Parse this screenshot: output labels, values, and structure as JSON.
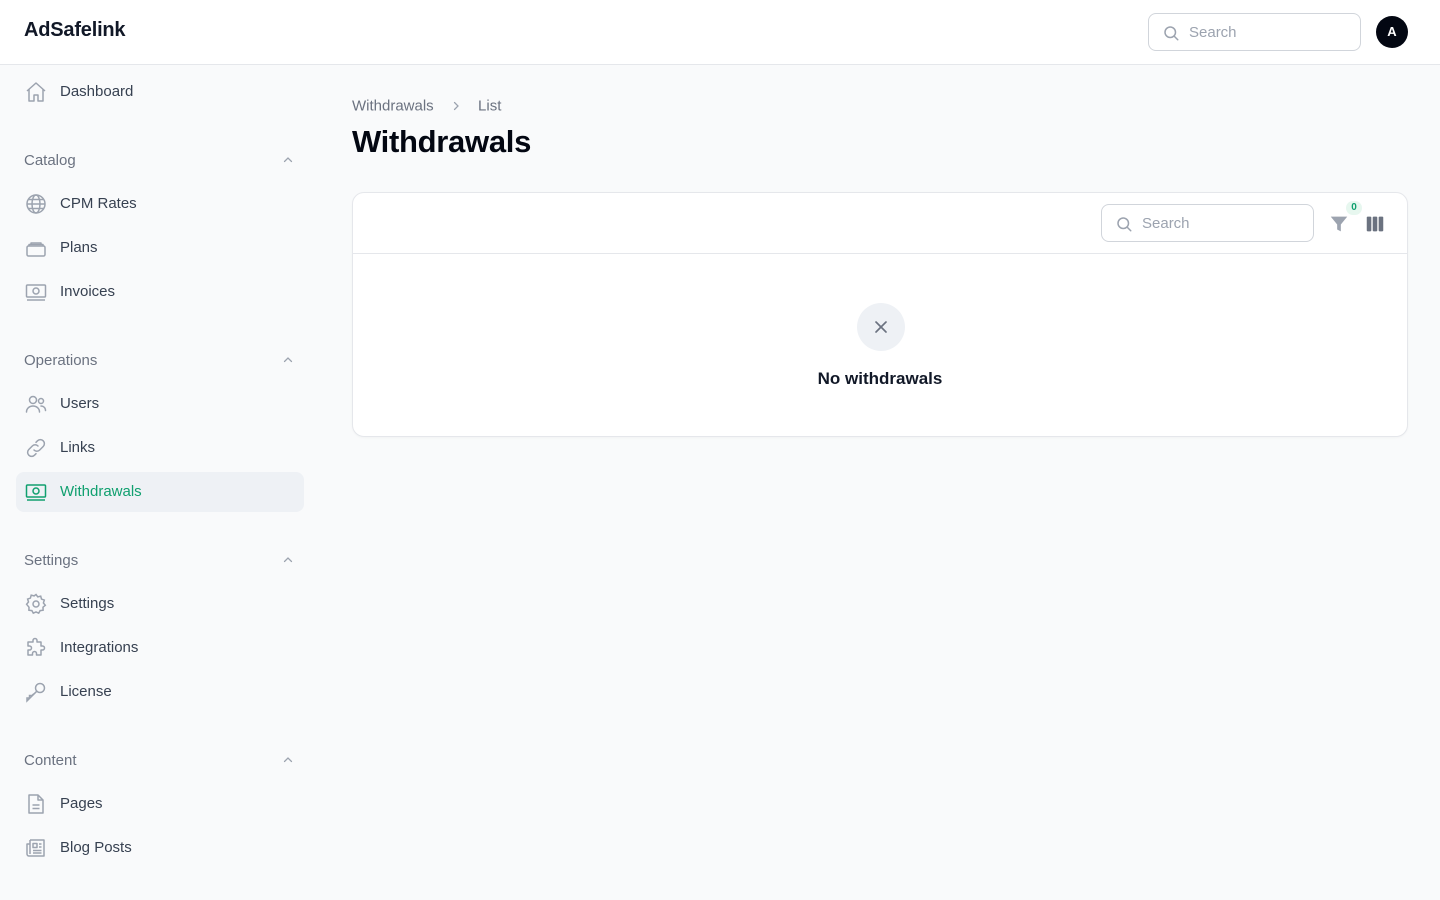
{
  "app": {
    "brand": "AdSafelink"
  },
  "header": {
    "search_placeholder": "Search",
    "avatar_initial": "A"
  },
  "sidebar": {
    "dashboard": "Dashboard",
    "groups": [
      {
        "label": "Catalog",
        "items": [
          "CPM Rates",
          "Plans",
          "Invoices"
        ]
      },
      {
        "label": "Operations",
        "items": [
          "Users",
          "Links",
          "Withdrawals"
        ]
      },
      {
        "label": "Settings",
        "items": [
          "Settings",
          "Integrations",
          "License"
        ]
      },
      {
        "label": "Content",
        "items": [
          "Pages",
          "Blog Posts"
        ]
      }
    ],
    "active_item": "Withdrawals"
  },
  "breadcrumb": {
    "parent": "Withdrawals",
    "current": "List"
  },
  "page": {
    "title": "Withdrawals"
  },
  "table": {
    "search_placeholder": "Search",
    "filter_count": "0",
    "empty_state": "No withdrawals"
  },
  "colors": {
    "accent": "#10a06f",
    "active_bg": "#eef1f5",
    "avatar_bg": "#030712"
  }
}
